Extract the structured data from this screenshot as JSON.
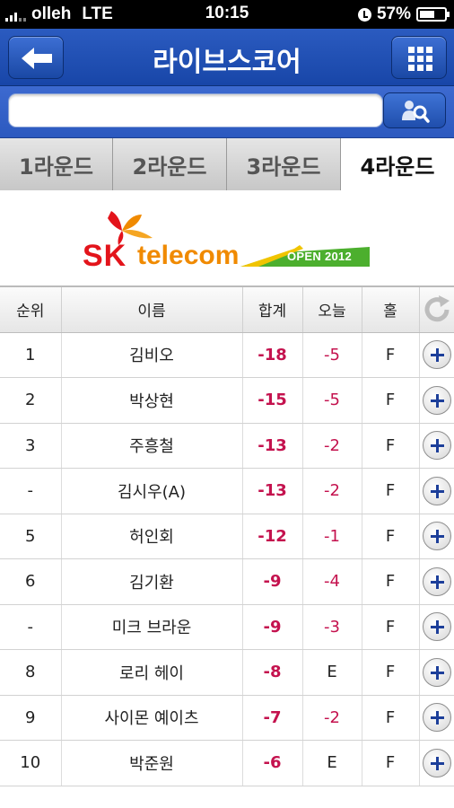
{
  "status_bar": {
    "carrier": "olleh",
    "network": "LTE",
    "time": "10:15",
    "battery": "57%"
  },
  "nav": {
    "title": "라이브스코어",
    "back_icon": "arrow-left-icon",
    "menu_icon": "grid-menu-icon"
  },
  "search": {
    "placeholder": "",
    "value": "",
    "button_icon": "player-search-icon"
  },
  "tabs": [
    {
      "label": "1라운드",
      "active": false
    },
    {
      "label": "2라운드",
      "active": false
    },
    {
      "label": "3라운드",
      "active": false
    },
    {
      "label": "4라운드",
      "active": true
    }
  ],
  "banner": {
    "brand_sk": "SK",
    "brand_telecom": "telecom",
    "event": "OPEN 2012"
  },
  "table": {
    "headers": {
      "rank": "순위",
      "name": "이름",
      "total": "합계",
      "today": "오늘",
      "hole": "홀",
      "refresh_icon": "refresh-icon"
    },
    "rows": [
      {
        "rank": "1",
        "name": "김비오",
        "total": "-18",
        "today": "-5",
        "hole": "F"
      },
      {
        "rank": "2",
        "name": "박상현",
        "total": "-15",
        "today": "-5",
        "hole": "F"
      },
      {
        "rank": "3",
        "name": "주흥철",
        "total": "-13",
        "today": "-2",
        "hole": "F"
      },
      {
        "rank": "-",
        "name": "김시우(A)",
        "total": "-13",
        "today": "-2",
        "hole": "F"
      },
      {
        "rank": "5",
        "name": "허인회",
        "total": "-12",
        "today": "-1",
        "hole": "F"
      },
      {
        "rank": "6",
        "name": "김기환",
        "total": "-9",
        "today": "-4",
        "hole": "F"
      },
      {
        "rank": "-",
        "name": "미크 브라운",
        "total": "-9",
        "today": "-3",
        "hole": "F"
      },
      {
        "rank": "8",
        "name": "로리 헤이",
        "total": "-8",
        "today": "E",
        "hole": "F"
      },
      {
        "rank": "9",
        "name": "사이몬 예이츠",
        "total": "-7",
        "today": "-2",
        "hole": "F"
      },
      {
        "rank": "10",
        "name": "박준원",
        "total": "-6",
        "today": "E",
        "hole": "F"
      }
    ]
  },
  "colors": {
    "nav_blue": "#1f4fb4",
    "score_red": "#c4124e",
    "plus_blue": "#1d3f9a",
    "sk_red": "#e3141b",
    "sk_orange": "#f08a00",
    "open_green": "#4caf2e"
  }
}
